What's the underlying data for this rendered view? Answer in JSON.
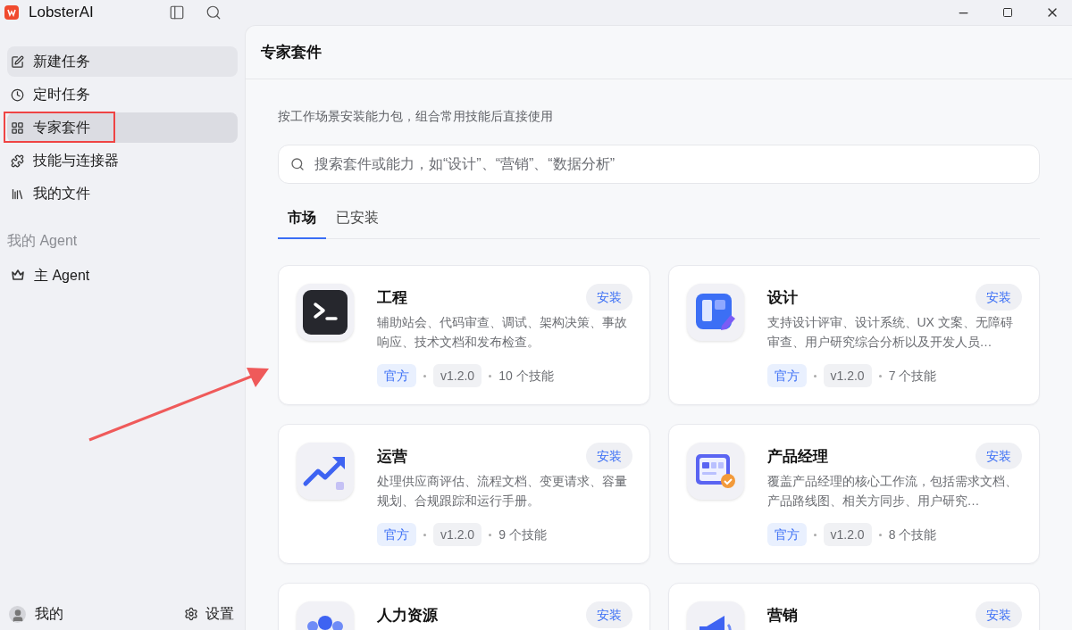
{
  "app": {
    "title": "LobsterAI"
  },
  "sidebar": {
    "items": [
      {
        "label": "新建任务",
        "selected": false,
        "hovered": true
      },
      {
        "label": "定时任务",
        "selected": false,
        "hovered": false
      },
      {
        "label": "专家套件",
        "selected": true,
        "hovered": false
      },
      {
        "label": "技能与连接器",
        "selected": false,
        "hovered": false
      },
      {
        "label": "我的文件",
        "selected": false,
        "hovered": false
      }
    ],
    "section_title": "我的 Agent",
    "agents": [
      {
        "label": "主 Agent"
      }
    ],
    "footer": {
      "user": "我的",
      "settings": "设置"
    }
  },
  "page": {
    "title": "专家套件",
    "intro": "按工作场景安装能力包，组合常用技能后直接使用",
    "search": {
      "placeholder": "搜索套件或能力，如“设计”、“营销”、“数据分析”"
    },
    "tabs": [
      {
        "label": "市场",
        "selected": true
      },
      {
        "label": "已安装",
        "selected": false
      }
    ],
    "cards": [
      {
        "name": "工程",
        "action": "安装",
        "description": "辅助站会、代码审查、调试、架构决策、事故响应、技术文档和发布检查。",
        "badge": "官方",
        "version": "v1.2.0",
        "skills": "10 个技能"
      },
      {
        "name": "设计",
        "action": "安装",
        "description": "支持设计评审、设计系统、UX 文案、无障碍审查、用户研究综合分析以及开发人员…",
        "badge": "官方",
        "version": "v1.2.0",
        "skills": "7 个技能"
      },
      {
        "name": "运营",
        "action": "安装",
        "description": "处理供应商评估、流程文档、变更请求、容量规划、合规跟踪和运行手册。",
        "badge": "官方",
        "version": "v1.2.0",
        "skills": "9 个技能"
      },
      {
        "name": "产品经理",
        "action": "安装",
        "description": "覆盖产品经理的核心工作流，包括需求文档、产品路线图、相关方同步、用户研究…",
        "badge": "官方",
        "version": "v1.2.0",
        "skills": "8 个技能"
      },
      {
        "name": "人力资源",
        "action": "安装"
      },
      {
        "name": "营销",
        "action": "安装"
      }
    ]
  }
}
